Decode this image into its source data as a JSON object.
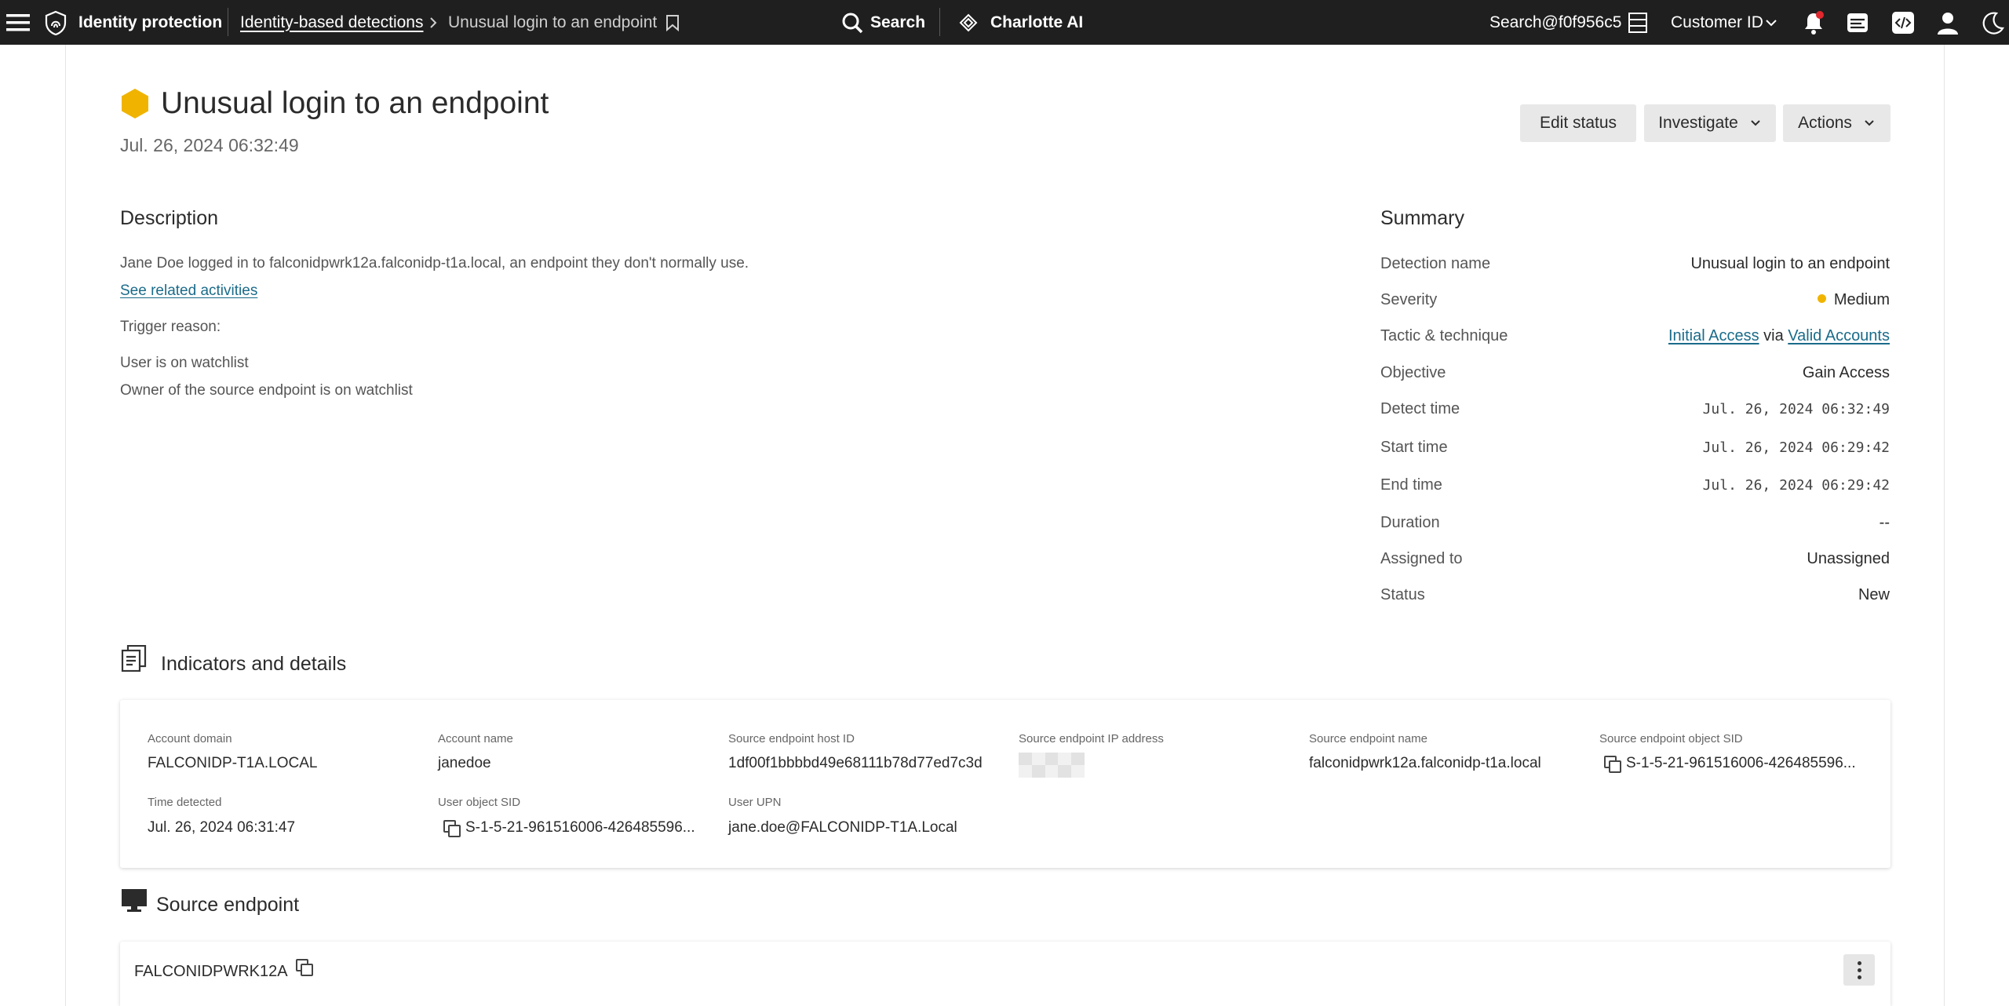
{
  "topbar": {
    "app_name": "Identity protection",
    "breadcrumb_link": "Identity-based detections",
    "breadcrumb_current": "Unusual login to an endpoint",
    "search_label": "Search",
    "charlotte_label": "Charlotte AI",
    "user_label": "Search@f0f956c5",
    "customer_label": "Customer ID"
  },
  "header": {
    "title": "Unusual login to an endpoint",
    "timestamp": "Jul. 26, 2024 06:32:49",
    "severity_color": "#f0b400",
    "buttons": {
      "edit_status": "Edit status",
      "investigate": "Investigate",
      "actions": "Actions"
    }
  },
  "description": {
    "heading": "Description",
    "text": "Jane Doe logged in to falconidpwrk12a.falconidp-t1a.local, an endpoint they don't normally use.",
    "related_link": "See related activities",
    "trigger_label": "Trigger reason:",
    "reasons": [
      "User is on watchlist",
      "Owner of the source endpoint is on watchlist"
    ]
  },
  "summary": {
    "heading": "Summary",
    "rows": {
      "detection_name": {
        "label": "Detection name",
        "value": "Unusual login to an endpoint"
      },
      "severity": {
        "label": "Severity",
        "value": "Medium"
      },
      "tactic": {
        "label": "Tactic & technique",
        "tactic": "Initial Access",
        "via": "via",
        "technique": "Valid Accounts"
      },
      "objective": {
        "label": "Objective",
        "value": "Gain Access"
      },
      "detect_time": {
        "label": "Detect time",
        "value": "Jul. 26, 2024 06:32:49"
      },
      "start_time": {
        "label": "Start time",
        "value": "Jul. 26, 2024 06:29:42"
      },
      "end_time": {
        "label": "End time",
        "value": "Jul. 26, 2024 06:29:42"
      },
      "duration": {
        "label": "Duration",
        "value": "--"
      },
      "assigned_to": {
        "label": "Assigned to",
        "value": "Unassigned"
      },
      "status": {
        "label": "Status",
        "value": "New"
      }
    }
  },
  "indicators": {
    "heading": "Indicators and details",
    "fields": {
      "account_domain": {
        "label": "Account domain",
        "value": "FALCONIDP-T1A.LOCAL"
      },
      "account_name": {
        "label": "Account name",
        "value": "janedoe"
      },
      "host_id": {
        "label": "Source endpoint host ID",
        "value": "1df00f1bbbbd49e68111b78d77ed7c3d"
      },
      "ip_address": {
        "label": "Source endpoint IP address"
      },
      "endpoint_name": {
        "label": "Source endpoint name",
        "value": "falconidpwrk12a.falconidp-t1a.local"
      },
      "endpoint_sid": {
        "label": "Source endpoint object SID",
        "value": "S-1-5-21-961516006-426485596..."
      },
      "time_detected": {
        "label": "Time detected",
        "value": "Jul. 26, 2024 06:31:47"
      },
      "user_sid": {
        "label": "User object SID",
        "value": "S-1-5-21-961516006-426485596..."
      },
      "user_upn": {
        "label": "User UPN",
        "value": "jane.doe@FALCONIDP-T1A.Local"
      }
    }
  },
  "source_endpoint": {
    "heading": "Source endpoint",
    "hostname": "FALCONIDPWRK12A"
  }
}
